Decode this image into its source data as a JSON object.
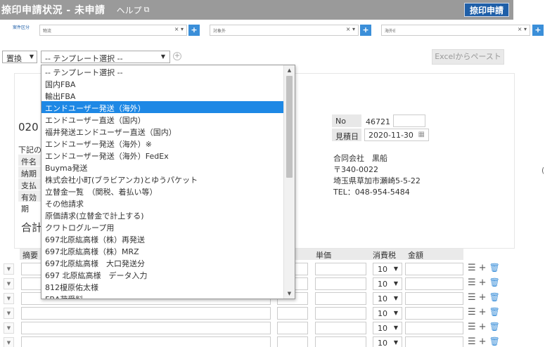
{
  "header": {
    "title": "捺印申請状況 - 未申請",
    "help": "ヘルプ",
    "stamp_button": "捺印申請"
  },
  "filters": {
    "label": "案件区分",
    "box1": "物流",
    "box2": "対象外",
    "box3": "海外E",
    "clear_arrow": "× ▾",
    "plus": "+"
  },
  "toolbar": {
    "replace": "置換",
    "template": "-- テンプレート選択 --",
    "excel_paste": "Excelからペースト"
  },
  "template_options": [
    "-- テンプレート選択 --",
    "国内FBA",
    "輸出FBA",
    "エンドユーザー発送（海外）",
    "エンドユーザー直送（国内）",
    "福井発送エンドユーザー直送（国内）",
    "エンドユーザー発送（海外）※",
    "エンドユーザー発送（海外）FedEx",
    "Buyma発送",
    "株式会社小町(ブラビアンカ)とゆうパケット",
    "立替金一覧　（関税、着払い等）",
    "その他請求",
    "原価請求(立替金で計上する)",
    "クワトログループ用",
    "697北原紘高様（株）再発送",
    "697北原紘高様（株）MRZ",
    "697北原紘高様　大口発送分",
    "697 北原紘高様　データ入力",
    "812榎原佑太様",
    "FBA荷受料"
  ],
  "selected_index": 3,
  "document": {
    "number_partial": "020",
    "note_partial": "下記の",
    "fields": [
      "件名",
      "納期",
      "支払",
      "有効期"
    ],
    "total_label": "合計"
  },
  "estimate": {
    "no_label": "No",
    "no_value": "46721",
    "date_label": "見積日",
    "date_value": "2020-11-30"
  },
  "company": {
    "name": "合同会社　黒船",
    "zip": "〒340-0022",
    "address": "埼玉県草加市瀬崎5-5-22",
    "tel": "TEL：048-954-5484"
  },
  "right_edge_char": "(",
  "table": {
    "col_summary": "摘要",
    "col_price": "単価",
    "col_tax": "消費税",
    "col_amount": "金額",
    "tax_value": "10"
  },
  "colors": {
    "titlebar": "#9a9a9a",
    "primary": "#1f5fa8",
    "plus": "#3b8fd9",
    "selected": "#1e88e5"
  }
}
